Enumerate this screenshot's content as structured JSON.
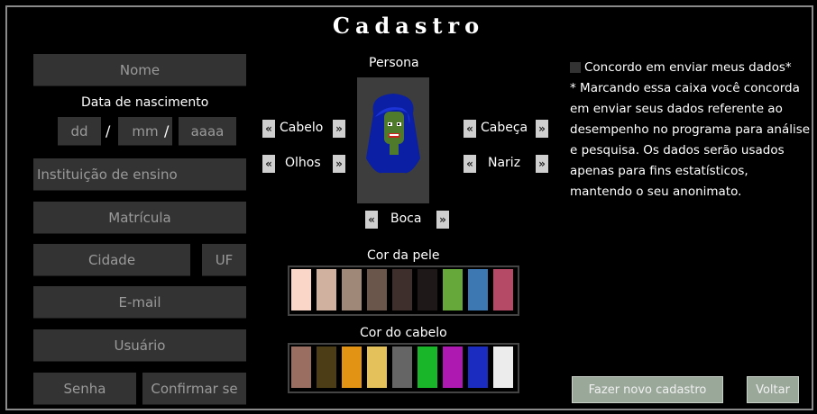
{
  "title": "Cadastro",
  "form": {
    "nome_placeholder": "Nome",
    "data_label": "Data de nascimento",
    "dd_placeholder": "dd",
    "mm_placeholder": "mm",
    "aaaa_placeholder": "aaaa",
    "date_sep": "/",
    "instituicao_placeholder": "Instituição de ensino",
    "matricula_placeholder": "Matrícula",
    "cidade_placeholder": "Cidade",
    "uf_placeholder": "UF",
    "email_placeholder": "E-mail",
    "usuario_placeholder": "Usuário",
    "senha_placeholder": "Senha",
    "confirmar_placeholder": "Confirmar se"
  },
  "persona": {
    "label": "Persona",
    "prev": "«",
    "next": "»",
    "cabelo": "Cabelo",
    "olhos": "Olhos",
    "cabeca": "Cabeça",
    "nariz": "Nariz",
    "boca": "Boca"
  },
  "skin": {
    "label": "Cor da pele",
    "colors": [
      "#f9d6c7",
      "#d0b1a0",
      "#9f8878",
      "#6b564c",
      "#3e2f2c",
      "#1e1819",
      "#67a83a",
      "#3e78b2",
      "#b44a66"
    ]
  },
  "hair": {
    "label": "Cor do cabelo",
    "colors": [
      "#9a6f62",
      "#4c3d16",
      "#e29314",
      "#e5c15c",
      "#656565",
      "#19b62a",
      "#ad19b1",
      "#1b2cc0",
      "#ececec"
    ]
  },
  "consent": {
    "checkbox_label": "Concordo em enviar meus dados*",
    "text": "* Marcando essa caixa você concorda em enviar seus dados referente ao desempenho no programa para análise e pesquisa. Os dados serão usados apenas para fins estatísticos, mantendo o seu anonimato."
  },
  "buttons": {
    "novo": "Fazer novo cadastro",
    "voltar": "Voltar"
  }
}
